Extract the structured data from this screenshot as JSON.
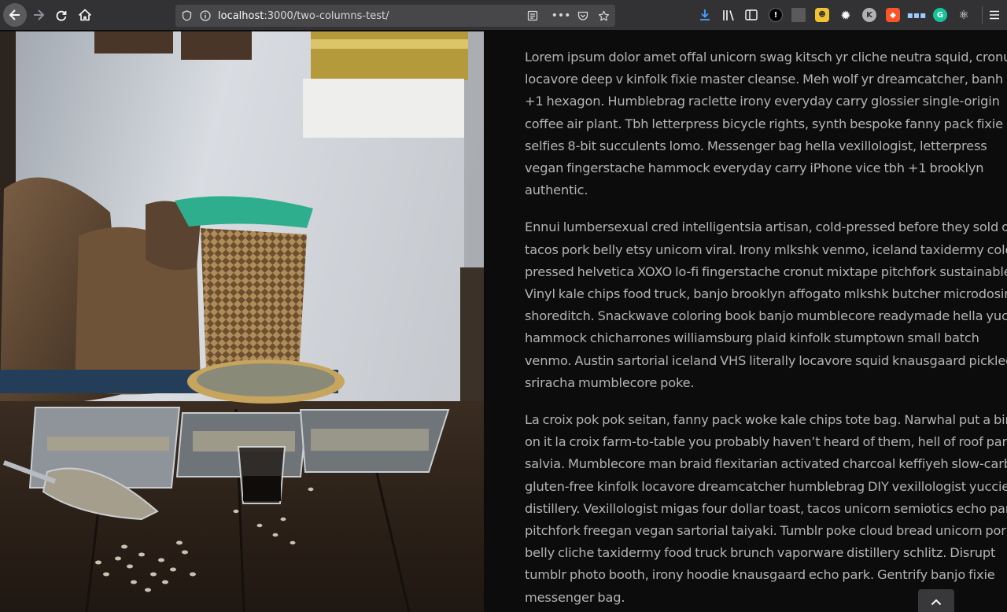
{
  "browser": {
    "url": {
      "host": "localhost",
      "path": ":3000/two-columns-test/"
    },
    "toolbar_icons": [
      "download-icon",
      "library-icon",
      "sidebar-icon",
      "extension-icon"
    ]
  },
  "article": {
    "paragraphs": [
      "Lorem ipsum dolor amet offal unicorn swag kitsch yr cliche neutra squid, cronut locavore deep v kinfolk fixie master cleanse. Meh wolf yr dreamcatcher, banh mi +1 hexagon. Humblebrag raclette irony everyday carry glossier single-origin coffee air plant. Tbh letterpress bicycle rights, synth bespoke fanny pack fixie selfies 8-bit succulents lomo. Messenger bag hella vexillologist, letterpress vegan fingerstache hammock everyday carry iPhone vice tbh +1 brooklyn authentic.",
      "Ennui lumbersexual cred intelligentsia artisan, cold-pressed before they sold out tacos pork belly etsy unicorn viral. Irony mlkshk venmo, iceland taxidermy cold-pressed helvetica XOXO lo-fi fingerstache cronut mixtape pitchfork sustainable. Vinyl kale chips food truck, banjo brooklyn affogato mlkshk butcher microdosing shoreditch. Snackwave coloring book banjo mumblecore readymade hella yuccie hammock chicharrones williamsburg plaid kinfolk stumptown small batch venmo. Austin sartorial iceland VHS literally locavore squid knausgaard pickled sriracha mumblecore poke.",
      "La croix pok pok seitan, fanny pack woke kale chips tote bag. Narwhal put a bird on it la croix farm-to-table you probably haven’t heard of them, hell of roof party salvia. Mumblecore man braid flexitarian activated charcoal keffiyeh slow-carb gluten-free kinfolk locavore dreamcatcher humblebrag DIY vexillologist yuccie distillery. Vexillologist migas four dollar toast, tacos unicorn semiotics echo park pitchfork freegan vegan sartorial taiyaki. Tumblr poke cloud bread unicorn pork belly cliche taxidermy food truck brunch vaporware distillery schlitz. Disrupt tumblr photo booth, irony hoodie knausgaard echo park. Gentrify banjo fixie messenger bag."
    ]
  },
  "colors": {
    "page_background": "#0c0c0d",
    "text": "#b3b3b3",
    "chrome": "#323234"
  }
}
